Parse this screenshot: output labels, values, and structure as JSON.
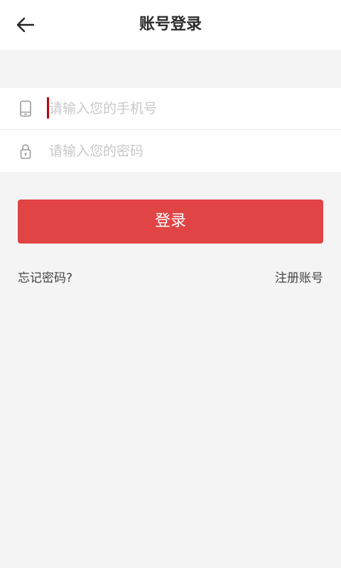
{
  "header": {
    "title": "账号登录",
    "back_icon": "arrow-left-icon"
  },
  "form": {
    "phone": {
      "placeholder": "请输入您的手机号",
      "value": "",
      "icon": "phone-icon"
    },
    "password": {
      "placeholder": "请输入您的密码",
      "value": "",
      "icon": "lock-icon"
    }
  },
  "actions": {
    "login_label": "登录",
    "forgot_label": "忘记密码?",
    "register_label": "注册账号"
  },
  "colors": {
    "accent": "#e04444",
    "background": "#f4f4f4",
    "cursor": "#c0000a"
  }
}
